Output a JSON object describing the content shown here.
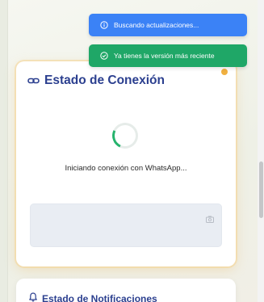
{
  "toasts": {
    "info": {
      "text": "Buscando actualizaciones...",
      "icon": "info-circle-icon"
    },
    "success": {
      "text": "Ya tienes la versión más reciente",
      "icon": "check-circle-icon"
    }
  },
  "connection_card": {
    "title": "Estado de Conexión",
    "title_icon": "link-icon",
    "status_text": "Iniciando conexión con WhatsApp...",
    "status_dot_color": "#f0b040",
    "spinner_color": "#26b36d"
  },
  "notifications_card": {
    "title": "Estado de Notificaciones",
    "title_icon": "bell-icon"
  },
  "colors": {
    "title": "#2b3f8f",
    "toast_info": "#3b82f6",
    "toast_success": "#1fa767"
  }
}
